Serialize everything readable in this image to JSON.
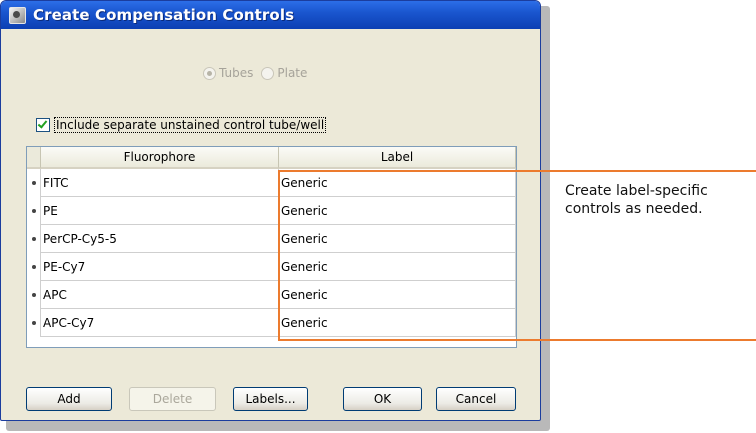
{
  "window": {
    "title": "Create Compensation Controls"
  },
  "radio_options": [
    {
      "label": "Tubes",
      "selected": true
    },
    {
      "label": "Plate",
      "selected": false
    }
  ],
  "include_unstained": {
    "label": "Include separate unstained control tube/well",
    "checked": true
  },
  "table": {
    "headers": [
      "Fluorophore",
      "Label"
    ],
    "rows": [
      {
        "fluorophore": "FITC",
        "label": "Generic"
      },
      {
        "fluorophore": "PE",
        "label": "Generic"
      },
      {
        "fluorophore": "PerCP-Cy5-5",
        "label": "Generic"
      },
      {
        "fluorophore": "PE-Cy7",
        "label": "Generic"
      },
      {
        "fluorophore": "APC",
        "label": "Generic"
      },
      {
        "fluorophore": "APC-Cy7",
        "label": "Generic"
      }
    ]
  },
  "buttons": {
    "add": "Add",
    "delete": "Delete",
    "labels": "Labels...",
    "ok": "OK",
    "cancel": "Cancel"
  },
  "callout": {
    "line1": "Create label-specific",
    "line2": "controls as needed."
  },
  "colors": {
    "titlebar": "#0c3fb3",
    "dialog_bg": "#ece9d8",
    "callout": "#ec7b2e"
  }
}
